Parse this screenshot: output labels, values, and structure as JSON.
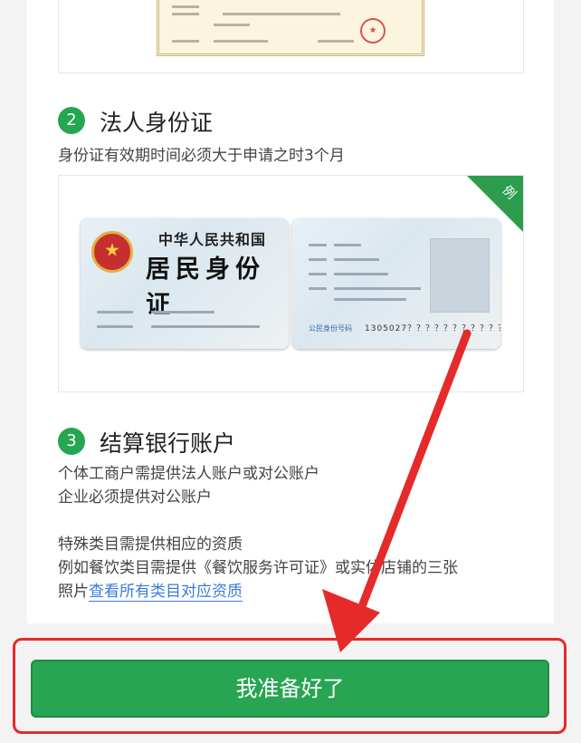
{
  "sections": [
    {
      "number": "2",
      "title": "法人身份证",
      "desc": "身份证有效期时间必须大于申请之时3个月"
    },
    {
      "number": "3",
      "title": "结算银行账户",
      "lines": [
        "个体工商户需提供法人账户或对公账户",
        "企业必须提供对公账户"
      ]
    }
  ],
  "special": {
    "line1": "特殊类目需提供相应的资质",
    "line2": "例如餐饮类目需提供《餐饮服务许可证》或实体店铺的三张",
    "line3_prefix": "照片",
    "link": "查看所有类目对应资质"
  },
  "id_sample": {
    "badge": "例",
    "front_title": "中华人民共和国",
    "front_subtitle": "居民身份证",
    "back_number_label": "公民身份号码",
    "back_number": "1305027？？？？？？？？？？？"
  },
  "ready_button": "我准备好了",
  "colors": {
    "brand_green": "#27a552",
    "highlight_red": "#e52a2a"
  }
}
